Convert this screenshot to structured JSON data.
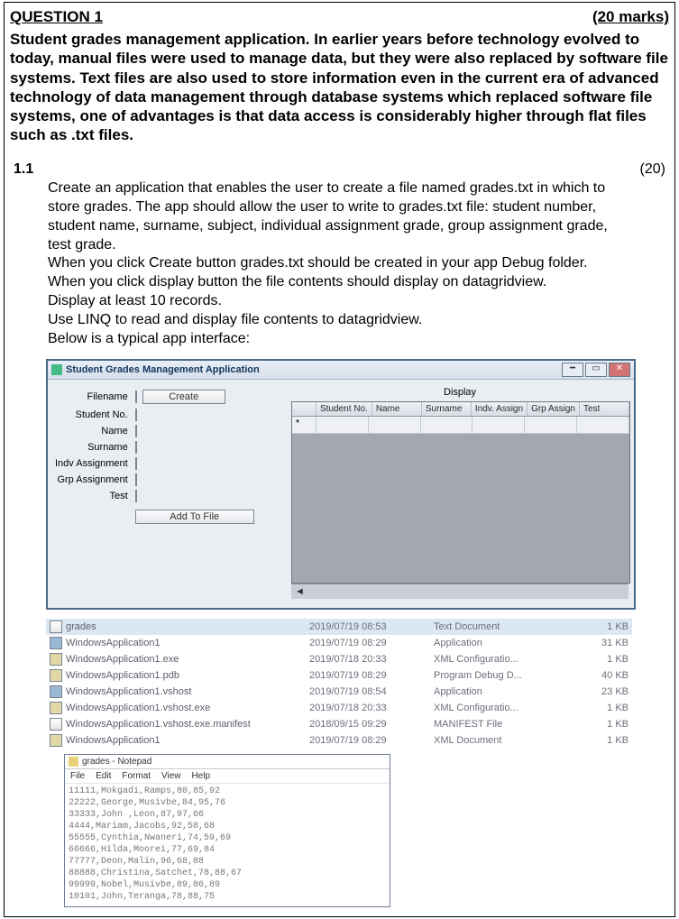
{
  "question": {
    "title_left": "QUESTION 1",
    "title_right": "(20 marks)",
    "intro": "Student grades management application. In earlier years before technology evolved to today, manual files were used to manage data, but they were also replaced by software file systems. Text files are also used to store information even in the current era of advanced technology of data management through database systems which replaced software file systems, one of advantages is that data access is considerably higher through flat files such as .txt files.",
    "sub_num": "1.1",
    "sub_marks": "(20)",
    "sub_body": "Create an application that enables the user to create a file named grades.txt in which to store grades. The app should allow the user to write to grades.txt file: student number, student name, surname, subject, individual assignment grade, group assignment grade, test grade.\nWhen you click Create button grades.txt should be created in your app Debug folder. When you click display button the file contents should display on datagridview.\nDisplay at least 10 records.\nUse LINQ to read and display file contents to datagridview.\nBelow is a typical app interface:"
  },
  "app": {
    "title": "Student Grades Management Application",
    "buttons": {
      "create": "Create",
      "add": "Add To File",
      "display": "Display"
    },
    "labels": {
      "filename": "Filename",
      "studentno": "Student No.",
      "name": "Name",
      "surname": "Surname",
      "indv": "Indv Assignment",
      "grp": "Grp Assignment",
      "test": "Test"
    },
    "grid_headers": [
      "Student No.",
      "Name",
      "Surname",
      "Indv. Assign",
      "Grp Assign",
      "Test"
    ]
  },
  "files": [
    {
      "icon": "txt",
      "name": "grades",
      "date": "2019/07/19 08:53",
      "type": "Text Document",
      "size": "1 KB",
      "hl": true
    },
    {
      "icon": "exe",
      "name": "WindowsApplication1",
      "date": "2019/07/19 08:29",
      "type": "Application",
      "size": "31 KB"
    },
    {
      "icon": "cfg",
      "name": "WindowsApplication1.exe",
      "date": "2019/07/18 20:33",
      "type": "XML Configuratio...",
      "size": "1 KB"
    },
    {
      "icon": "cfg",
      "name": "WindowsApplication1.pdb",
      "date": "2019/07/19 08:29",
      "type": "Program Debug D...",
      "size": "40 KB"
    },
    {
      "icon": "exe",
      "name": "WindowsApplication1.vshost",
      "date": "2019/07/19 08:54",
      "type": "Application",
      "size": "23 KB"
    },
    {
      "icon": "cfg",
      "name": "WindowsApplication1.vshost.exe",
      "date": "2019/07/18 20:33",
      "type": "XML Configuratio...",
      "size": "1 KB"
    },
    {
      "icon": "txt",
      "name": "WindowsApplication1.vshost.exe.manifest",
      "date": "2018/09/15 09:29",
      "type": "MANIFEST File",
      "size": "1 KB"
    },
    {
      "icon": "cfg",
      "name": "WindowsApplication1",
      "date": "2019/07/19 08:29",
      "type": "XML Document",
      "size": "1 KB"
    }
  ],
  "notepad": {
    "title": "grades - Notepad",
    "menu": [
      "File",
      "Edit",
      "Format",
      "View",
      "Help"
    ],
    "lines": [
      "11111,Mokgadi,Ramps,80,85,92",
      "22222,George,Musivbe,84,95,76",
      "33333,John ,Leon,87,97,66",
      "4444,Mariam,Jacobs,92,58,68",
      "55555,Cynthia,Nwaneri,74,59,69",
      "66666,Hilda,Moorei,77,69,84",
      "77777,Deon,Malin,96,68,88",
      "88888,Christina,Satchet,78,88,67",
      "99999,Nobel,Musivbe,89,86,89",
      "10101,John,Teranga,78,88,75"
    ]
  }
}
